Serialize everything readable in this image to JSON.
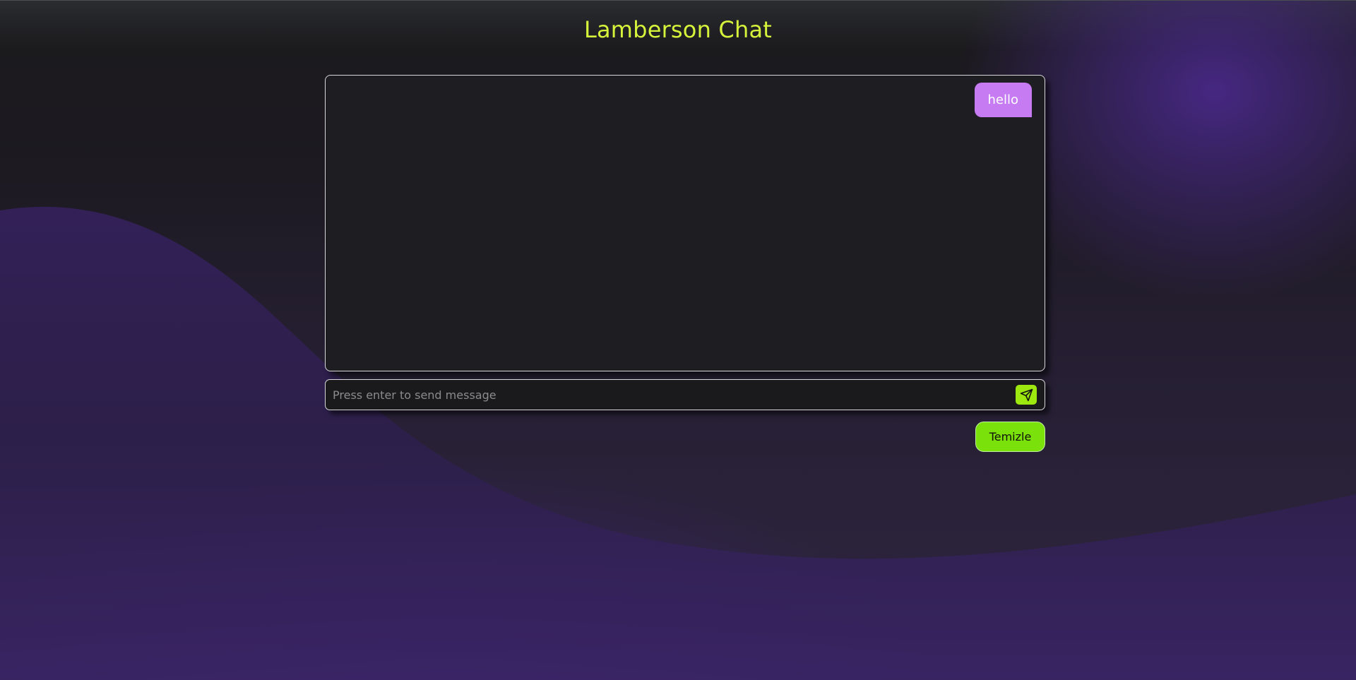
{
  "app": {
    "title": "Lamberson Chat"
  },
  "chat": {
    "messages": [
      {
        "role": "user",
        "text": "hello"
      }
    ]
  },
  "composer": {
    "value": "",
    "placeholder": "Press enter to send message",
    "send_icon": "send-paper-plane-icon"
  },
  "actions": {
    "clear_label": "Temizle"
  },
  "theme": {
    "title_color": "#d6f23a",
    "user_bubble_color": "#c67bf3",
    "send_button_color": "#9de80f",
    "clear_button_color": "#7ae10a",
    "panel_color": "#1e1d21"
  }
}
